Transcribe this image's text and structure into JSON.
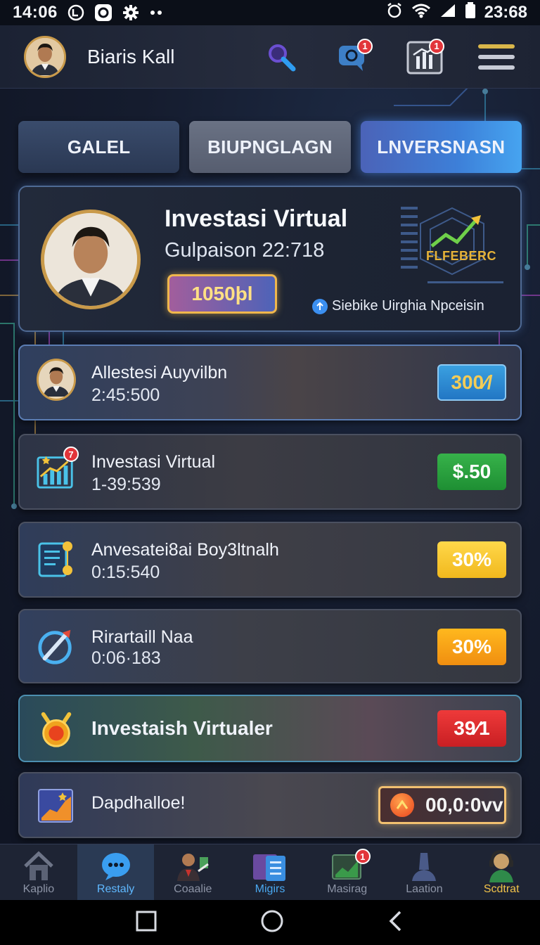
{
  "status_bar": {
    "time": "14:06",
    "clock": "23:68"
  },
  "header": {
    "user_name": "Biaris Kall",
    "messages_badge": "1",
    "stats_badge": "1"
  },
  "tabs": [
    "GALEL",
    "BIUPNGLAGN",
    "LNVERSNASN"
  ],
  "hero": {
    "title": "Investasi Virtual",
    "subtitle": "Gulpaison 22:718",
    "amount": "1050þl",
    "logo_text": "FLFEBERC",
    "note": "Siebike Uirghia Npceisin"
  },
  "rows": [
    {
      "title": "Allestesi Auyvilbn",
      "subtitle": "2:45:500",
      "value": "300⁄/"
    },
    {
      "title": "Investasi Virtual",
      "subtitle": "1-39:539",
      "value": "$.50",
      "badge": "7"
    },
    {
      "title": "Anvesatei8ai Boy3ltnalh",
      "subtitle": "0:15:540",
      "value": "30%"
    },
    {
      "title": "Rirartaill Naa",
      "subtitle": "0:06·183",
      "value": "30%"
    },
    {
      "title": "Investaish Virtualer",
      "value": "39⁄1"
    },
    {
      "title": "Dapdhalloe!",
      "value": "00,0:0vv"
    }
  ],
  "bottom_nav": [
    {
      "label": "Kaplio"
    },
    {
      "label": "Restaly"
    },
    {
      "label": "Coaalie"
    },
    {
      "label": "Migirs"
    },
    {
      "label": "Masirag",
      "badge": "1"
    },
    {
      "label": "Laation"
    },
    {
      "label": "Scdtrat"
    }
  ],
  "colors": {
    "accent": "#3d7fd8",
    "gold": "#f0b74c",
    "badge": "#e2353a"
  }
}
